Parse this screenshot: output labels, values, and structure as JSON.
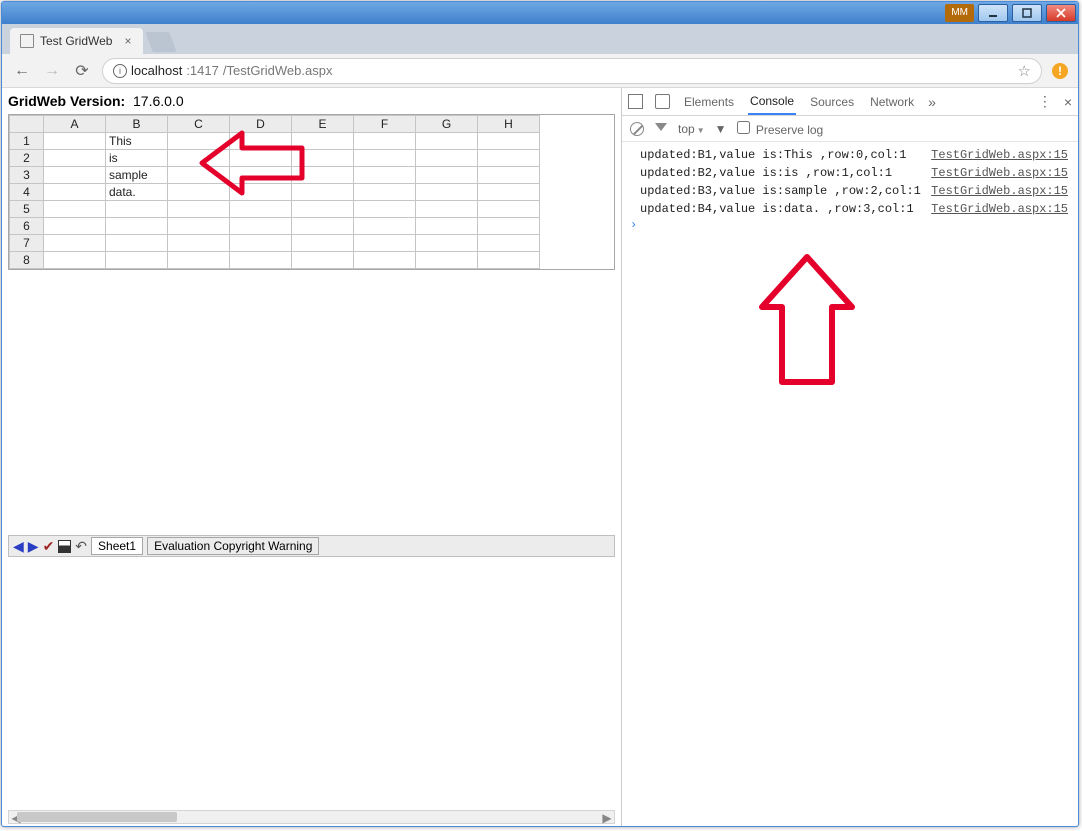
{
  "window": {
    "user_badge": "MM"
  },
  "browser": {
    "tab_title": "Test GridWeb",
    "address_host": "localhost",
    "address_port": ":1417",
    "address_path": "/TestGridWeb.aspx"
  },
  "gridweb": {
    "header_label": "GridWeb Version:",
    "version": "17.6.0.0",
    "columns": [
      "A",
      "B",
      "C",
      "D",
      "E",
      "F",
      "G",
      "H"
    ],
    "rows": [
      {
        "n": "1",
        "cells": [
          "",
          "This",
          "",
          "",
          "",
          "",
          "",
          ""
        ]
      },
      {
        "n": "2",
        "cells": [
          "",
          "is",
          "",
          "",
          "",
          "",
          "",
          ""
        ]
      },
      {
        "n": "3",
        "cells": [
          "",
          "sample",
          "",
          "",
          "",
          "",
          "",
          ""
        ]
      },
      {
        "n": "4",
        "cells": [
          "",
          "data.",
          "",
          "",
          "",
          "",
          "",
          ""
        ]
      },
      {
        "n": "5",
        "cells": [
          "",
          "",
          "",
          "",
          "",
          "",
          "",
          ""
        ]
      },
      {
        "n": "6",
        "cells": [
          "",
          "",
          "",
          "",
          "",
          "",
          "",
          ""
        ]
      },
      {
        "n": "7",
        "cells": [
          "",
          "",
          "",
          "",
          "",
          "",
          "",
          ""
        ]
      },
      {
        "n": "8",
        "cells": [
          "",
          "",
          "",
          "",
          "",
          "",
          "",
          ""
        ]
      }
    ],
    "sheet_tab": "Sheet1",
    "warning_tab": "Evaluation Copyright Warning"
  },
  "devtools": {
    "tabs": {
      "elements": "Elements",
      "console": "Console",
      "sources": "Sources",
      "network": "Network"
    },
    "top_label": "top",
    "preserve_label": "Preserve log",
    "logs": [
      {
        "msg": "updated:B1,value is:This ,row:0,col:1",
        "src": "TestGridWeb.aspx:15"
      },
      {
        "msg": "updated:B2,value is:is ,row:1,col:1",
        "src": "TestGridWeb.aspx:15"
      },
      {
        "msg": "updated:B3,value is:sample ,row:2,col:1",
        "src": "TestGridWeb.aspx:15"
      },
      {
        "msg": "updated:B4,value is:data. ,row:3,col:1",
        "src": "TestGridWeb.aspx:15"
      }
    ]
  }
}
